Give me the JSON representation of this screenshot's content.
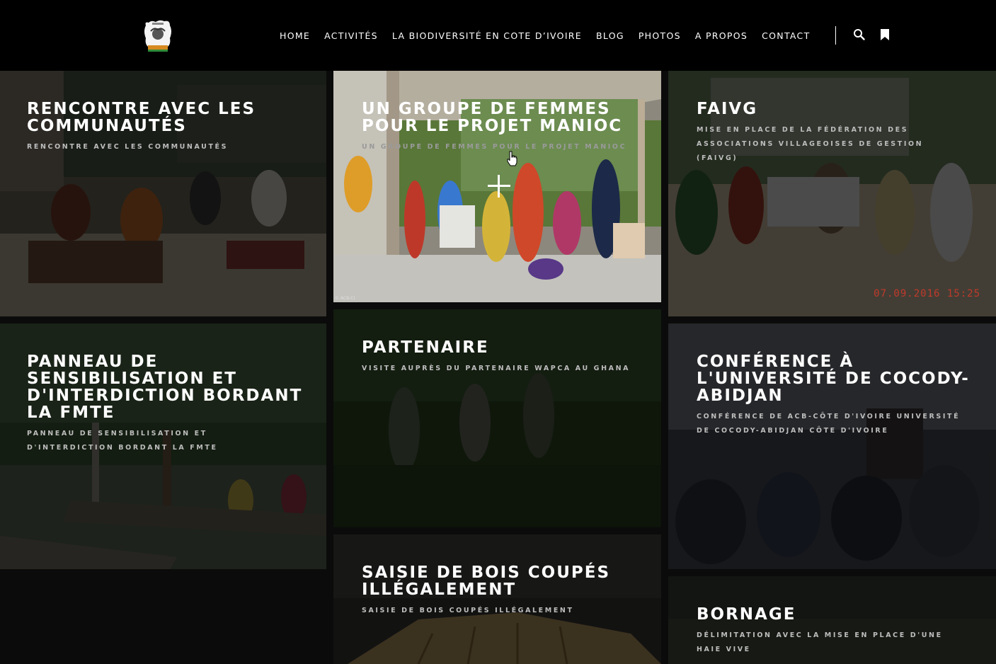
{
  "nav": {
    "items": [
      "HOME",
      "ACTIVITÉS",
      "LA BIODIVERSITÉ EN COTE D’IVOIRE",
      "BLOG",
      "PHOTOS",
      "A PROPOS",
      "CONTACT"
    ],
    "icons": [
      "search-icon",
      "bookmark-icon"
    ]
  },
  "tiles": [
    {
      "title": "RENCONTRE AVEC LES COMMUNAUTÉS",
      "subtitle": "RENCONTRE AVEC LES COMMUNAUTÉS"
    },
    {
      "title": "UN GROUPE DE FEMMES POUR LE PROJET MANIOC",
      "subtitle": "UN GROUPE DE FEMMES POUR LE PROJET MANIOC",
      "credit": "© ACB-CI"
    },
    {
      "title": "FAIVG",
      "subtitle": "MISE EN PLACE DE LA FÉDÉRATION DES ASSOCIATIONS VILLAGEOISES DE GESTION (FAIVG)",
      "date_stamp": "07.09.2016 15:25"
    },
    {
      "title": "PANNEAU DE SENSIBILISATION ET D'INTERDICTION BORDANT LA FMTE",
      "subtitle": "PANNEAU DE SENSIBILISATION ET D'INTERDICTION BORDANT LA FMTE"
    },
    {
      "title": "PARTENAIRE",
      "subtitle": "VISITE AUPRÈS DU PARTENAIRE WAPCA AU GHANA"
    },
    {
      "title": "CONFÉRENCE À L'UNIVERSITÉ DE COCODY-ABIDJAN",
      "subtitle": "CONFÉRENCE DE ACB-CÔTE D'IVOIRE UNIVERSITÉ DE COCODY-ABIDJAN CÔTE D'IVOIRE"
    },
    {
      "title": "SAISIE DE BOIS COUPÉS ILLÉGALEMENT",
      "subtitle": "SAISIE DE BOIS COUPÉS ILLÉGALEMENT"
    },
    {
      "title": "BORNAGE",
      "subtitle": "DÉLIMITATION AVEC LA MISE EN PLACE D'UNE HAIE VIVE"
    }
  ]
}
